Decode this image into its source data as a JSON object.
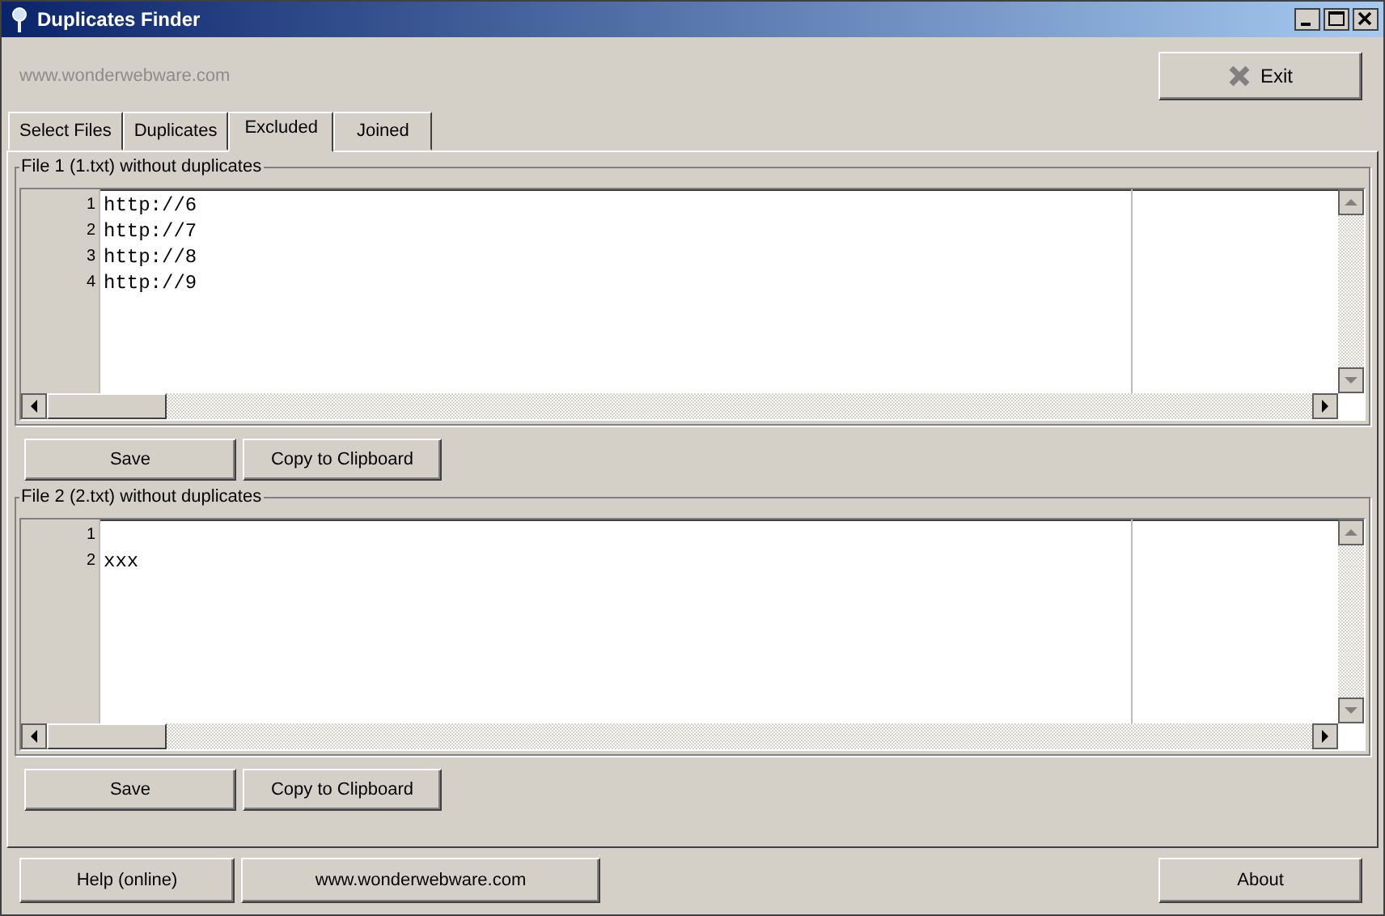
{
  "window": {
    "title": "Duplicates Finder"
  },
  "site_text": "www.wonderwebware.com",
  "exit_button": "Exit",
  "tabs": [
    {
      "label": "Select Files",
      "selected": false
    },
    {
      "label": "Duplicates",
      "selected": false
    },
    {
      "label": "Excluded",
      "selected": true
    },
    {
      "label": "Joined",
      "selected": false
    }
  ],
  "panels": [
    {
      "title": "File 1 (1.txt) without duplicates",
      "lines": [
        {
          "number": "1",
          "text": "http://6"
        },
        {
          "number": "2",
          "text": "http://7"
        },
        {
          "number": "3",
          "text": "http://8"
        },
        {
          "number": "4",
          "text": "http://9"
        }
      ],
      "buttons": [
        "Save",
        "Copy to Clipboard"
      ]
    },
    {
      "title": "File 2 (2.txt) without duplicates",
      "lines": [
        {
          "number": "1"
        },
        {
          "number": "2",
          "text": "xxx"
        }
      ],
      "buttons": [
        "Save",
        "Copy to Clipboard"
      ]
    }
  ],
  "footer_buttons": [
    "Help (online)",
    "www.wonderwebware.com",
    "About"
  ]
}
